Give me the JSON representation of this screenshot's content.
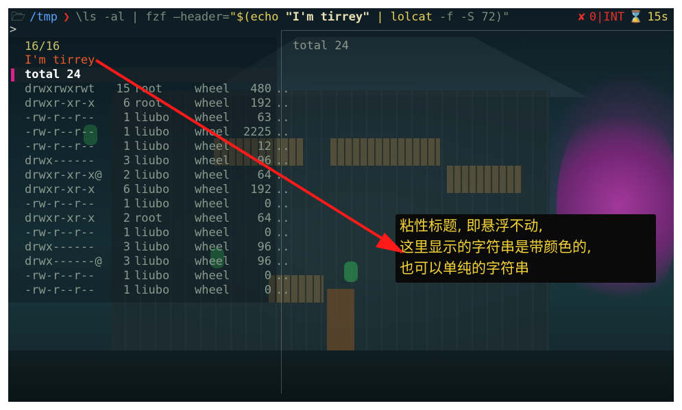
{
  "command": {
    "apple": "",
    "folder": "🗁",
    "path": "/tmp",
    "chevron": "❯",
    "ls": "\\ls -al",
    "pipe1": "|",
    "fzf": "fzf",
    "flag": "—header=",
    "sub_open": "\"$(",
    "echo": "echo",
    "echo_str": "\"I'm tirrey\"",
    "pipe2": "|",
    "lolcat": "lolcat",
    "lolcat_args": "-f -S 72)\""
  },
  "status": {
    "x_mark": "✘",
    "code": "0|INT",
    "hourglass": "⌛",
    "duration": "15s"
  },
  "prompt_symbol": ">",
  "fzf": {
    "counter": "16/16",
    "header": "I'm tirrey",
    "selected": "total 24",
    "rows": [
      {
        "perm": "drwxrwxrwt",
        "links": "15",
        "owner": "root",
        "group": "wheel",
        "size": "480",
        "trunc": ".."
      },
      {
        "perm": "drwxr-xr-x",
        "links": "6",
        "owner": "root",
        "group": "wheel",
        "size": "192",
        "trunc": ".."
      },
      {
        "perm": "-rw-r--r--",
        "links": "1",
        "owner": "liubo",
        "group": "wheel",
        "size": "63",
        "trunc": ".."
      },
      {
        "perm": "-rw-r--r--",
        "links": "1",
        "owner": "liubo",
        "group": "wheel",
        "size": "2225",
        "trunc": ".."
      },
      {
        "perm": "-rw-r--r--",
        "links": "1",
        "owner": "liubo",
        "group": "wheel",
        "size": "12",
        "trunc": ".."
      },
      {
        "perm": "drwx------",
        "links": "3",
        "owner": "liubo",
        "group": "wheel",
        "size": "96",
        "trunc": ".."
      },
      {
        "perm": "drwxr-xr-x@",
        "links": "2",
        "owner": "liubo",
        "group": "wheel",
        "size": "64",
        "trunc": ".."
      },
      {
        "perm": "drwxr-xr-x",
        "links": "6",
        "owner": "liubo",
        "group": "wheel",
        "size": "192",
        "trunc": ".."
      },
      {
        "perm": "-rw-r--r--",
        "links": "1",
        "owner": "liubo",
        "group": "wheel",
        "size": "0",
        "trunc": ".."
      },
      {
        "perm": "drwxr-xr-x",
        "links": "2",
        "owner": "root",
        "group": "wheel",
        "size": "64",
        "trunc": ".."
      },
      {
        "perm": "-rw-r--r--",
        "links": "1",
        "owner": "liubo",
        "group": "wheel",
        "size": "0",
        "trunc": ".."
      },
      {
        "perm": "drwx------",
        "links": "3",
        "owner": "liubo",
        "group": "wheel",
        "size": "96",
        "trunc": ".."
      },
      {
        "perm": "drwx------@",
        "links": "3",
        "owner": "liubo",
        "group": "wheel",
        "size": "96",
        "trunc": ".."
      },
      {
        "perm": "-rw-r--r--",
        "links": "1",
        "owner": "liubo",
        "group": "wheel",
        "size": "0",
        "trunc": ".."
      },
      {
        "perm": "-rw-r--r--",
        "links": "1",
        "owner": "liubo",
        "group": "wheel",
        "size": "0",
        "trunc": ".."
      }
    ],
    "preview": "total 24"
  },
  "callout": {
    "line1": "粘性标题, 即悬浮不动,",
    "line2": "这里显示的字符串是带颜色的,",
    "line3": "也可以单纯的字符串"
  },
  "colors": {
    "header": "#ef5a2a",
    "cursor_bar": "#d8248a",
    "callout_text": "#f3d23a",
    "arrow": "#ff1a1a"
  }
}
